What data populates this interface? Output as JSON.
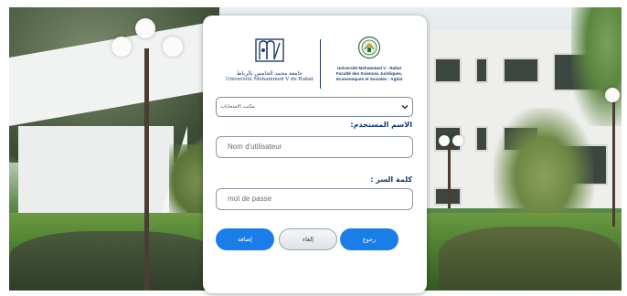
{
  "logo": {
    "arabic_name": "جامعة محمد الخامس بالرباط",
    "french_name": "Université Mohammed V de Rabat",
    "faculty_lines": [
      "Université Mohammed V - Rabat",
      "Faculté des Sciences Juridiques,",
      "Economiques et Sociales - Agdal"
    ],
    "brand_color": "#1e3a6e"
  },
  "form": {
    "service_select": {
      "selected": "مكتب الامتحانات",
      "icon": "chevron-down-icon"
    },
    "username": {
      "label": "الاسم المستخدم:",
      "placeholder": "Nom d'utilisateur"
    },
    "password": {
      "label": "كلمة السر :",
      "placeholder": "mot de passe"
    },
    "buttons": {
      "submit": "إضافة",
      "cancel": "إلغاء",
      "back": "رجوع"
    },
    "accent_color": "#1b7de8"
  }
}
